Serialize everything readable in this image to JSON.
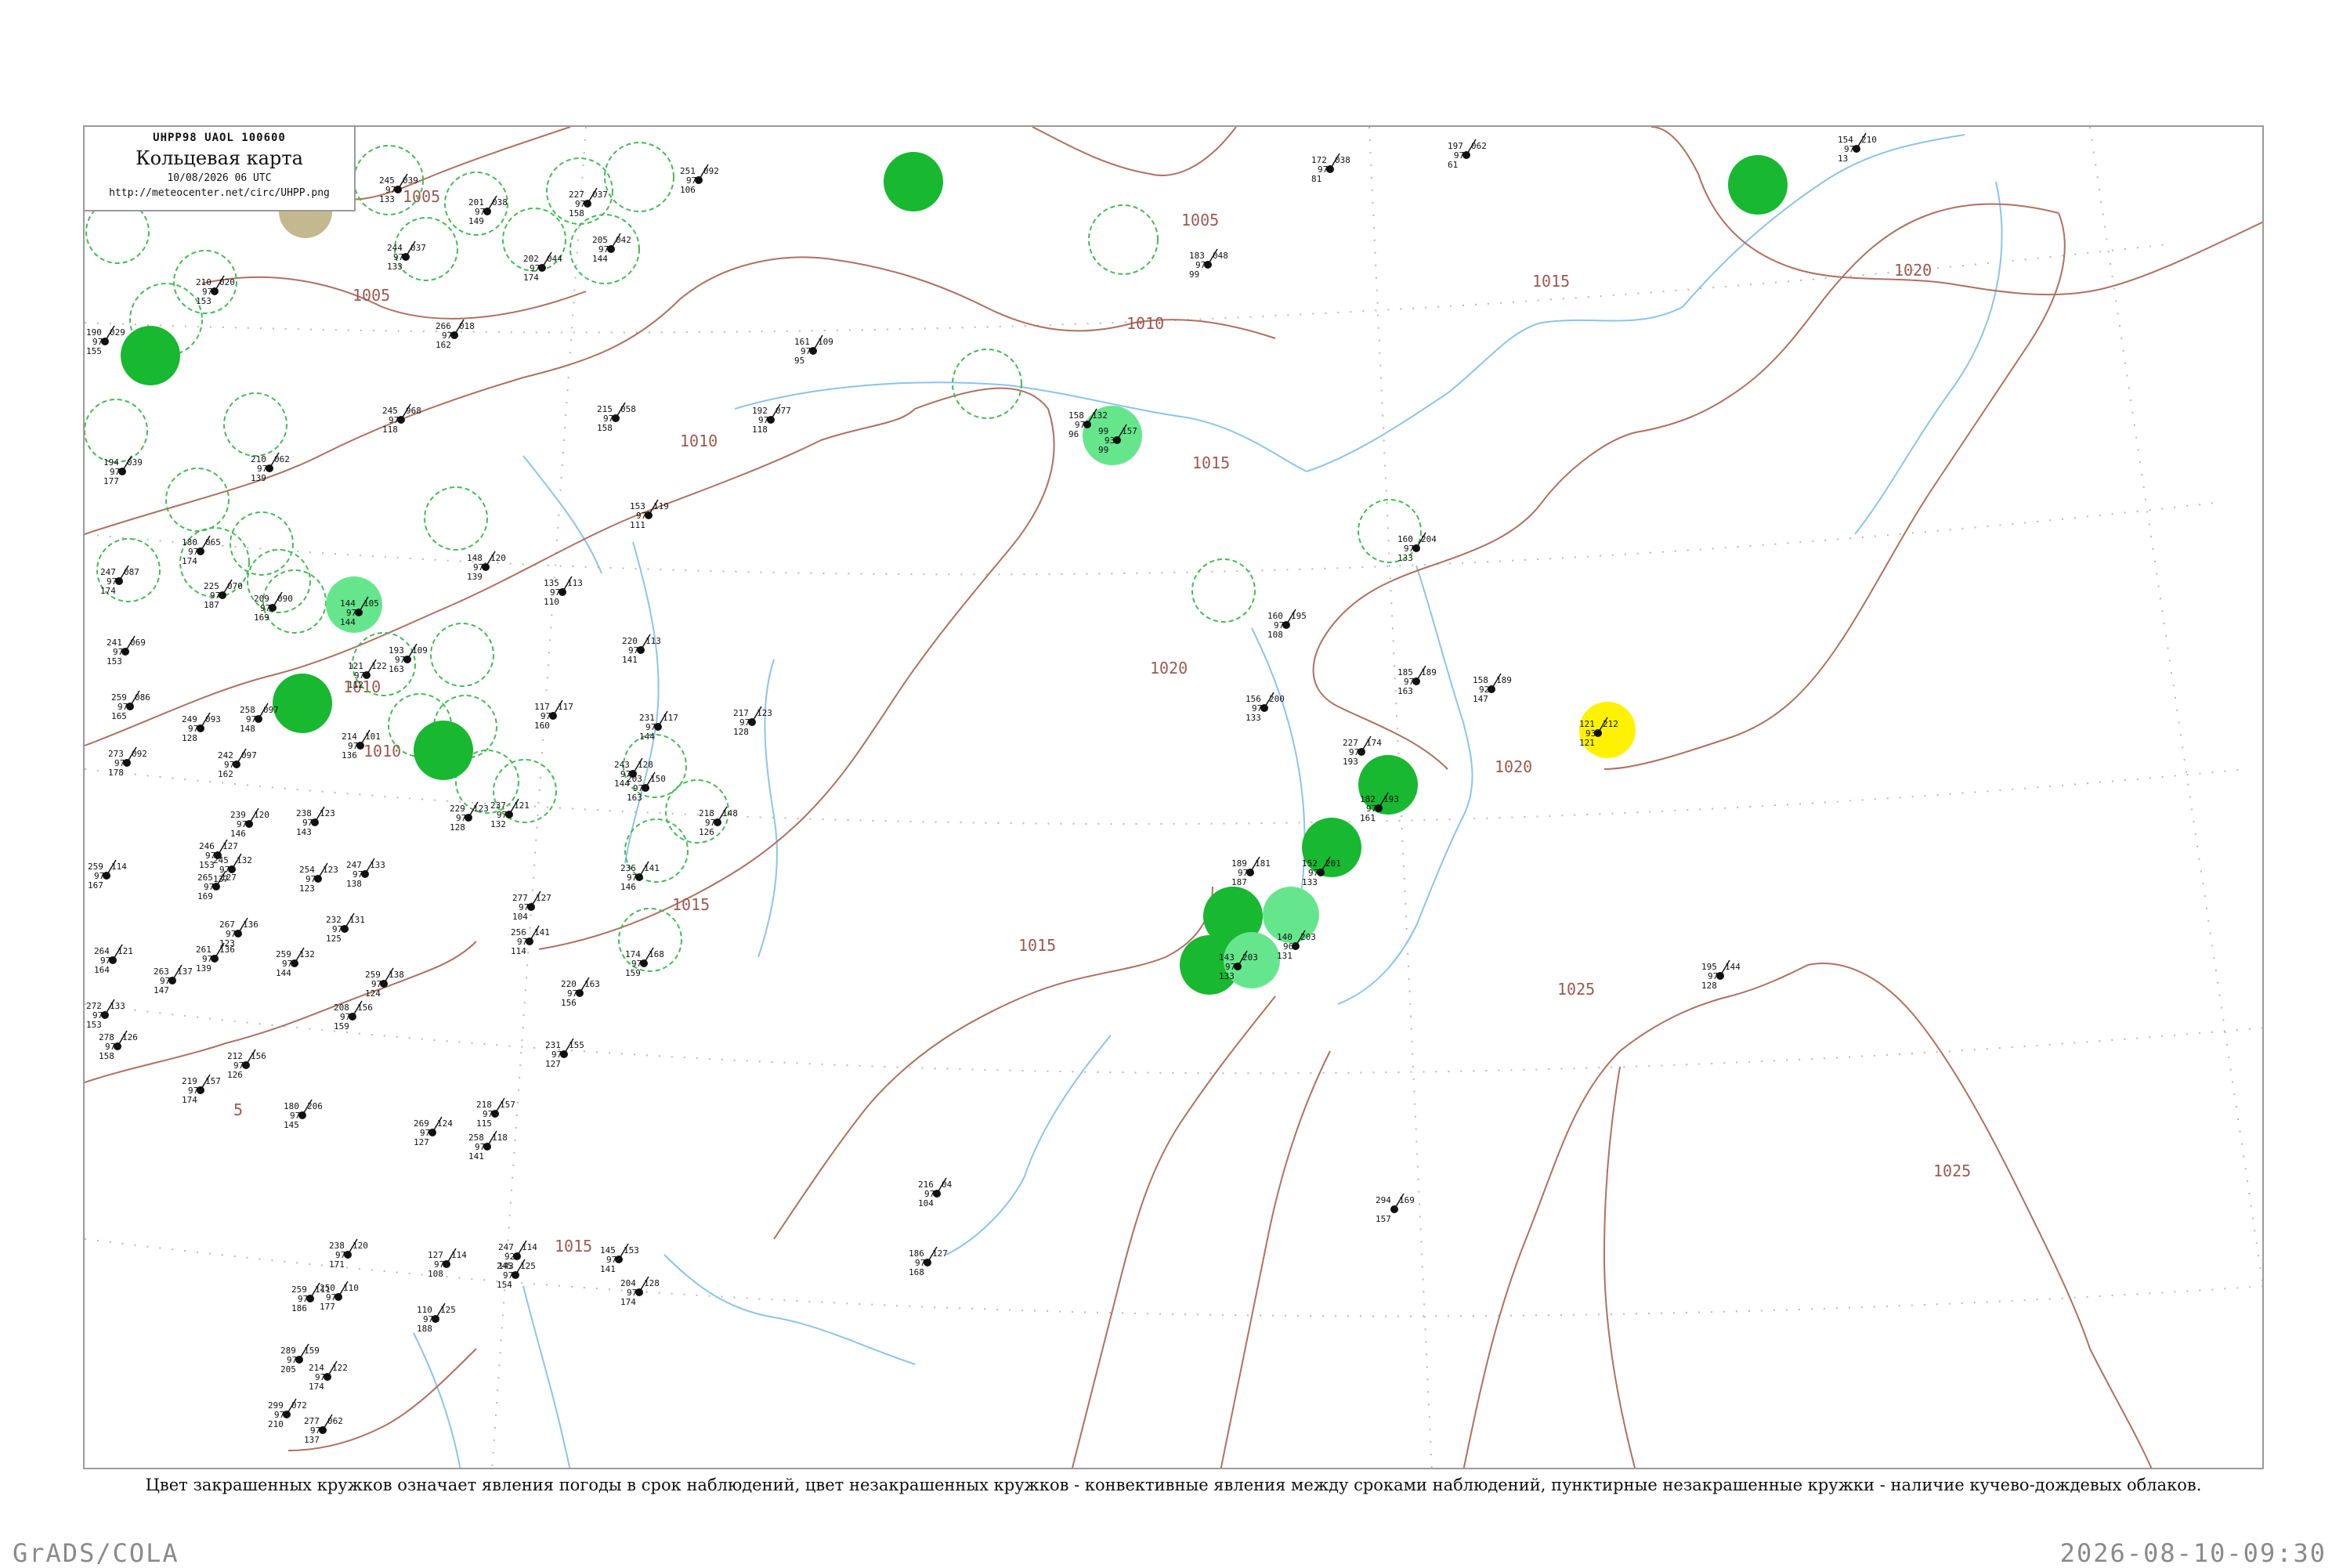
{
  "title_box": {
    "code": "UHPP98  UAOL  100600",
    "title": "Кольцевая карта",
    "date": "10/08/2026 06 UTC",
    "url": "http://meteocenter.net/circ/UHPP.png"
  },
  "colors": {
    "isobar": "#b07060",
    "coastline": "#8cc4ea",
    "grid": "#b0b0b0",
    "phenomenon_dark_green": "#18b830",
    "phenomenon_light_green": "#66e68c",
    "phenomenon_yellow": "#fff200",
    "convective_ring": "#44bb55"
  },
  "isobar_labels": [
    "1005",
    "1005",
    "1005",
    "1010",
    "1010",
    "1010",
    "1010",
    "1015",
    "1015",
    "1015",
    "1015",
    "1015",
    "1020",
    "1020",
    "1020",
    "1025",
    "1025",
    "5"
  ],
  "stations": [
    {
      "temp": "245",
      "pres": "039",
      "vis": "97",
      "dew": "133"
    },
    {
      "temp": "201",
      "pres": "038",
      "vis": "97",
      "dew": "149"
    },
    {
      "temp": "227",
      "pres": "037",
      "vis": "97",
      "dew": "158"
    },
    {
      "temp": "251",
      "pres": "092",
      "vis": "97",
      "dew": "106"
    },
    {
      "temp": "190",
      "pres": "029",
      "vis": "97",
      "dew": "155"
    },
    {
      "temp": "210",
      "pres": "020",
      "vis": "97",
      "dew": "153"
    },
    {
      "temp": "244",
      "pres": "037",
      "vis": "97",
      "dew": "133"
    },
    {
      "temp": "202",
      "pres": "044",
      "vis": "97",
      "dew": "174"
    },
    {
      "temp": "205",
      "pres": "042",
      "vis": "97",
      "dew": "144"
    },
    {
      "temp": "266",
      "pres": "018",
      "vis": "97",
      "dew": "162"
    },
    {
      "temp": "172",
      "pres": "038",
      "vis": "97",
      "dew": "81"
    },
    {
      "temp": "197",
      "pres": "062",
      "vis": "97",
      "dew": "61"
    },
    {
      "temp": "154",
      "pres": "210",
      "vis": "97",
      "dew": "13"
    },
    {
      "temp": "183",
      "pres": "048",
      "vis": "97",
      "dew": "99"
    },
    {
      "temp": "161",
      "pres": "109",
      "vis": "97",
      "dew": "95"
    },
    {
      "temp": "245",
      "pres": "968",
      "vis": "97",
      "dew": "118"
    },
    {
      "temp": "215",
      "pres": "058",
      "vis": "97",
      "dew": "158"
    },
    {
      "temp": "192",
      "pres": "077",
      "vis": "97",
      "dew": "118"
    },
    {
      "temp": "158",
      "pres": "132",
      "vis": "97",
      "dew": "96"
    },
    {
      "temp": "99",
      "pres": "157",
      "vis": "93",
      "dew": "99"
    },
    {
      "temp": "210",
      "pres": "062",
      "vis": "97",
      "dew": "139"
    },
    {
      "temp": "194",
      "pres": "039",
      "vis": "97",
      "dew": "177"
    },
    {
      "temp": "153",
      "pres": "119",
      "vis": "97",
      "dew": "111"
    },
    {
      "temp": "180",
      "pres": "065",
      "vis": "97",
      "dew": "174"
    },
    {
      "temp": "148",
      "pres": "120",
      "vis": "97",
      "dew": "139"
    },
    {
      "temp": "247",
      "pres": "087",
      "vis": "97",
      "dew": "174"
    },
    {
      "temp": "225",
      "pres": "070",
      "vis": "97",
      "dew": "187"
    },
    {
      "temp": "209",
      "pres": "090",
      "vis": "97",
      "dew": "169"
    },
    {
      "temp": "144",
      "pres": "105",
      "vis": "97",
      "dew": "144"
    },
    {
      "temp": "135",
      "pres": "113",
      "vis": "97",
      "dew": "110"
    },
    {
      "temp": "160",
      "pres": "204",
      "vis": "97",
      "dew": "133"
    },
    {
      "temp": "160",
      "pres": "195",
      "vis": "97",
      "dew": "108"
    },
    {
      "temp": "241",
      "pres": "069",
      "vis": "97",
      "dew": "153"
    },
    {
      "temp": "193",
      "pres": "109",
      "vis": "97",
      "dew": "163"
    },
    {
      "temp": "220",
      "pres": "113",
      "vis": "97",
      "dew": "141"
    },
    {
      "temp": "185",
      "pres": "189",
      "vis": "97",
      "dew": "163"
    },
    {
      "temp": "158",
      "pres": "189",
      "vis": "92",
      "dew": "147"
    },
    {
      "temp": "259",
      "pres": "086",
      "vis": "97",
      "dew": "165"
    },
    {
      "temp": "258",
      "pres": "097",
      "vis": "97",
      "dew": "148"
    },
    {
      "temp": "249",
      "pres": "093",
      "vis": "97",
      "dew": "128"
    },
    {
      "temp": "121",
      "pres": "122",
      "vis": "97",
      "dew": "112"
    },
    {
      "temp": "117",
      "pres": "117",
      "vis": "97",
      "dew": "160"
    },
    {
      "temp": "231",
      "pres": "117",
      "vis": "97",
      "dew": "144"
    },
    {
      "temp": "217",
      "pres": "123",
      "vis": "97",
      "dew": "128"
    },
    {
      "temp": "156",
      "pres": "200",
      "vis": "97",
      "dew": "133"
    },
    {
      "temp": "227",
      "pres": "174",
      "vis": "97",
      "dew": "193"
    },
    {
      "temp": "121",
      "pres": "212",
      "vis": "93",
      "dew": "121"
    },
    {
      "temp": "273",
      "pres": "092",
      "vis": "97",
      "dew": "178"
    },
    {
      "temp": "242",
      "pres": "097",
      "vis": "97",
      "dew": "162"
    },
    {
      "temp": "214",
      "pres": "101",
      "vis": "97",
      "dew": "136"
    },
    {
      "temp": "243",
      "pres": "128",
      "vis": "97",
      "dew": "144"
    },
    {
      "temp": "203",
      "pres": "150",
      "vis": "97",
      "dew": "163"
    },
    {
      "temp": "218",
      "pres": "148",
      "vis": "97",
      "dew": "126"
    },
    {
      "temp": "182",
      "pres": "193",
      "vis": "97",
      "dew": "161"
    },
    {
      "temp": "239",
      "pres": "120",
      "vis": "97",
      "dew": "146"
    },
    {
      "temp": "238",
      "pres": "123",
      "vis": "97",
      "dew": "143"
    },
    {
      "temp": "229",
      "pres": "123",
      "vis": "97",
      "dew": "128"
    },
    {
      "temp": "237",
      "pres": "121",
      "vis": "97",
      "dew": "132"
    },
    {
      "temp": "246",
      "pres": "127",
      "vis": "97",
      "dew": "153"
    },
    {
      "temp": "259",
      "pres": "114",
      "vis": "97",
      "dew": "167"
    },
    {
      "temp": "245",
      "pres": "132",
      "vis": "97",
      "dew": "137"
    },
    {
      "temp": "254",
      "pres": "123",
      "vis": "97",
      "dew": "123"
    },
    {
      "temp": "247",
      "pres": "133",
      "vis": "97",
      "dew": "138"
    },
    {
      "temp": "236",
      "pres": "141",
      "vis": "97",
      "dew": "146"
    },
    {
      "temp": "189",
      "pres": "181",
      "vis": "97",
      "dew": "187"
    },
    {
      "temp": "152",
      "pres": "201",
      "vis": "97",
      "dew": "133"
    },
    {
      "temp": "265",
      "pres": "127",
      "vis": "97",
      "dew": "169"
    },
    {
      "temp": "232",
      "pres": "131",
      "vis": "97",
      "dew": "125"
    },
    {
      "temp": "277",
      "pres": "127",
      "vis": "97",
      "dew": "104"
    },
    {
      "temp": "256",
      "pres": "141",
      "vis": "97",
      "dew": "114"
    },
    {
      "temp": "267",
      "pres": "136",
      "vis": "97",
      "dew": "123"
    },
    {
      "temp": "140",
      "pres": "203",
      "vis": "96",
      "dew": "131"
    },
    {
      "temp": "264",
      "pres": "121",
      "vis": "97",
      "dew": "164"
    },
    {
      "temp": "261",
      "pres": "136",
      "vis": "97",
      "dew": "139"
    },
    {
      "temp": "259",
      "pres": "132",
      "vis": "97",
      "dew": "144"
    },
    {
      "temp": "174",
      "pres": "168",
      "vis": "97",
      "dew": "159"
    },
    {
      "temp": "143",
      "pres": "203",
      "vis": "97",
      "dew": "133"
    },
    {
      "temp": "263",
      "pres": "137",
      "vis": "97",
      "dew": "147"
    },
    {
      "temp": "259",
      "pres": "138",
      "vis": "97",
      "dew": "124"
    },
    {
      "temp": "220",
      "pres": "163",
      "vis": "97",
      "dew": "156"
    },
    {
      "temp": "195",
      "pres": "144",
      "vis": "97",
      "dew": "128"
    },
    {
      "temp": "272",
      "pres": "133",
      "vis": "97",
      "dew": "153"
    },
    {
      "temp": "208",
      "pres": "156",
      "vis": "97",
      "dew": "159"
    },
    {
      "temp": "231",
      "pres": "155",
      "vis": "97",
      "dew": "127"
    },
    {
      "temp": "278",
      "pres": "126",
      "vis": "97",
      "dew": "158"
    },
    {
      "temp": "212",
      "pres": "156",
      "vis": "97",
      "dew": "126"
    },
    {
      "temp": "219",
      "pres": "157",
      "vis": "97",
      "dew": "174"
    },
    {
      "temp": "218",
      "pres": "157",
      "vis": "97",
      "dew": "115"
    },
    {
      "temp": "180",
      "pres": "206",
      "vis": "97",
      "dew": "145"
    },
    {
      "temp": "269",
      "pres": "124",
      "vis": "97",
      "dew": "127"
    },
    {
      "temp": "258",
      "pres": "118",
      "vis": "97",
      "dew": "141"
    },
    {
      "temp": "216",
      "pres": "04",
      "vis": "97",
      "dew": "104"
    },
    {
      "temp": "294",
      "pres": "169",
      "vis": "",
      "dew": "157"
    },
    {
      "temp": "238",
      "pres": "120",
      "vis": "97",
      "dew": "171"
    },
    {
      "temp": "127",
      "pres": "114",
      "vis": "97",
      "dew": "108"
    },
    {
      "temp": "247",
      "pres": "114",
      "vis": "92",
      "dew": "143"
    },
    {
      "temp": "245",
      "pres": "125",
      "vis": "97",
      "dew": "154"
    },
    {
      "temp": "145",
      "pres": "153",
      "vis": "97",
      "dew": "141"
    },
    {
      "temp": "204",
      "pres": "128",
      "vis": "97",
      "dew": "174"
    },
    {
      "temp": "186",
      "pres": "127",
      "vis": "97",
      "dew": "168"
    },
    {
      "temp": "250",
      "pres": "110",
      "vis": "97",
      "dew": "177"
    },
    {
      "temp": "259",
      "pres": "111",
      "vis": "97",
      "dew": "186"
    },
    {
      "temp": "110",
      "pres": "125",
      "vis": "97",
      "dew": "188"
    },
    {
      "temp": "289",
      "pres": "159",
      "vis": "97",
      "dew": "205"
    },
    {
      "temp": "214",
      "pres": "122",
      "vis": "97",
      "dew": "174"
    },
    {
      "temp": "299",
      "pres": "072",
      "vis": "97",
      "dew": "210"
    },
    {
      "temp": "277",
      "pres": "062",
      "vis": "97",
      "dew": "137"
    }
  ],
  "footer": {
    "note": "Цвет закрашенных кружков означает явления погоды в срок наблюдений, цвет незакрашенных кружков - конвективные явления между сроками наблюдений, пунктирные незакрашенные кружки - наличие кучево-дождевых облаков.",
    "credit": "GrADS/COLA",
    "timestamp": "2026-08-10-09:30"
  }
}
